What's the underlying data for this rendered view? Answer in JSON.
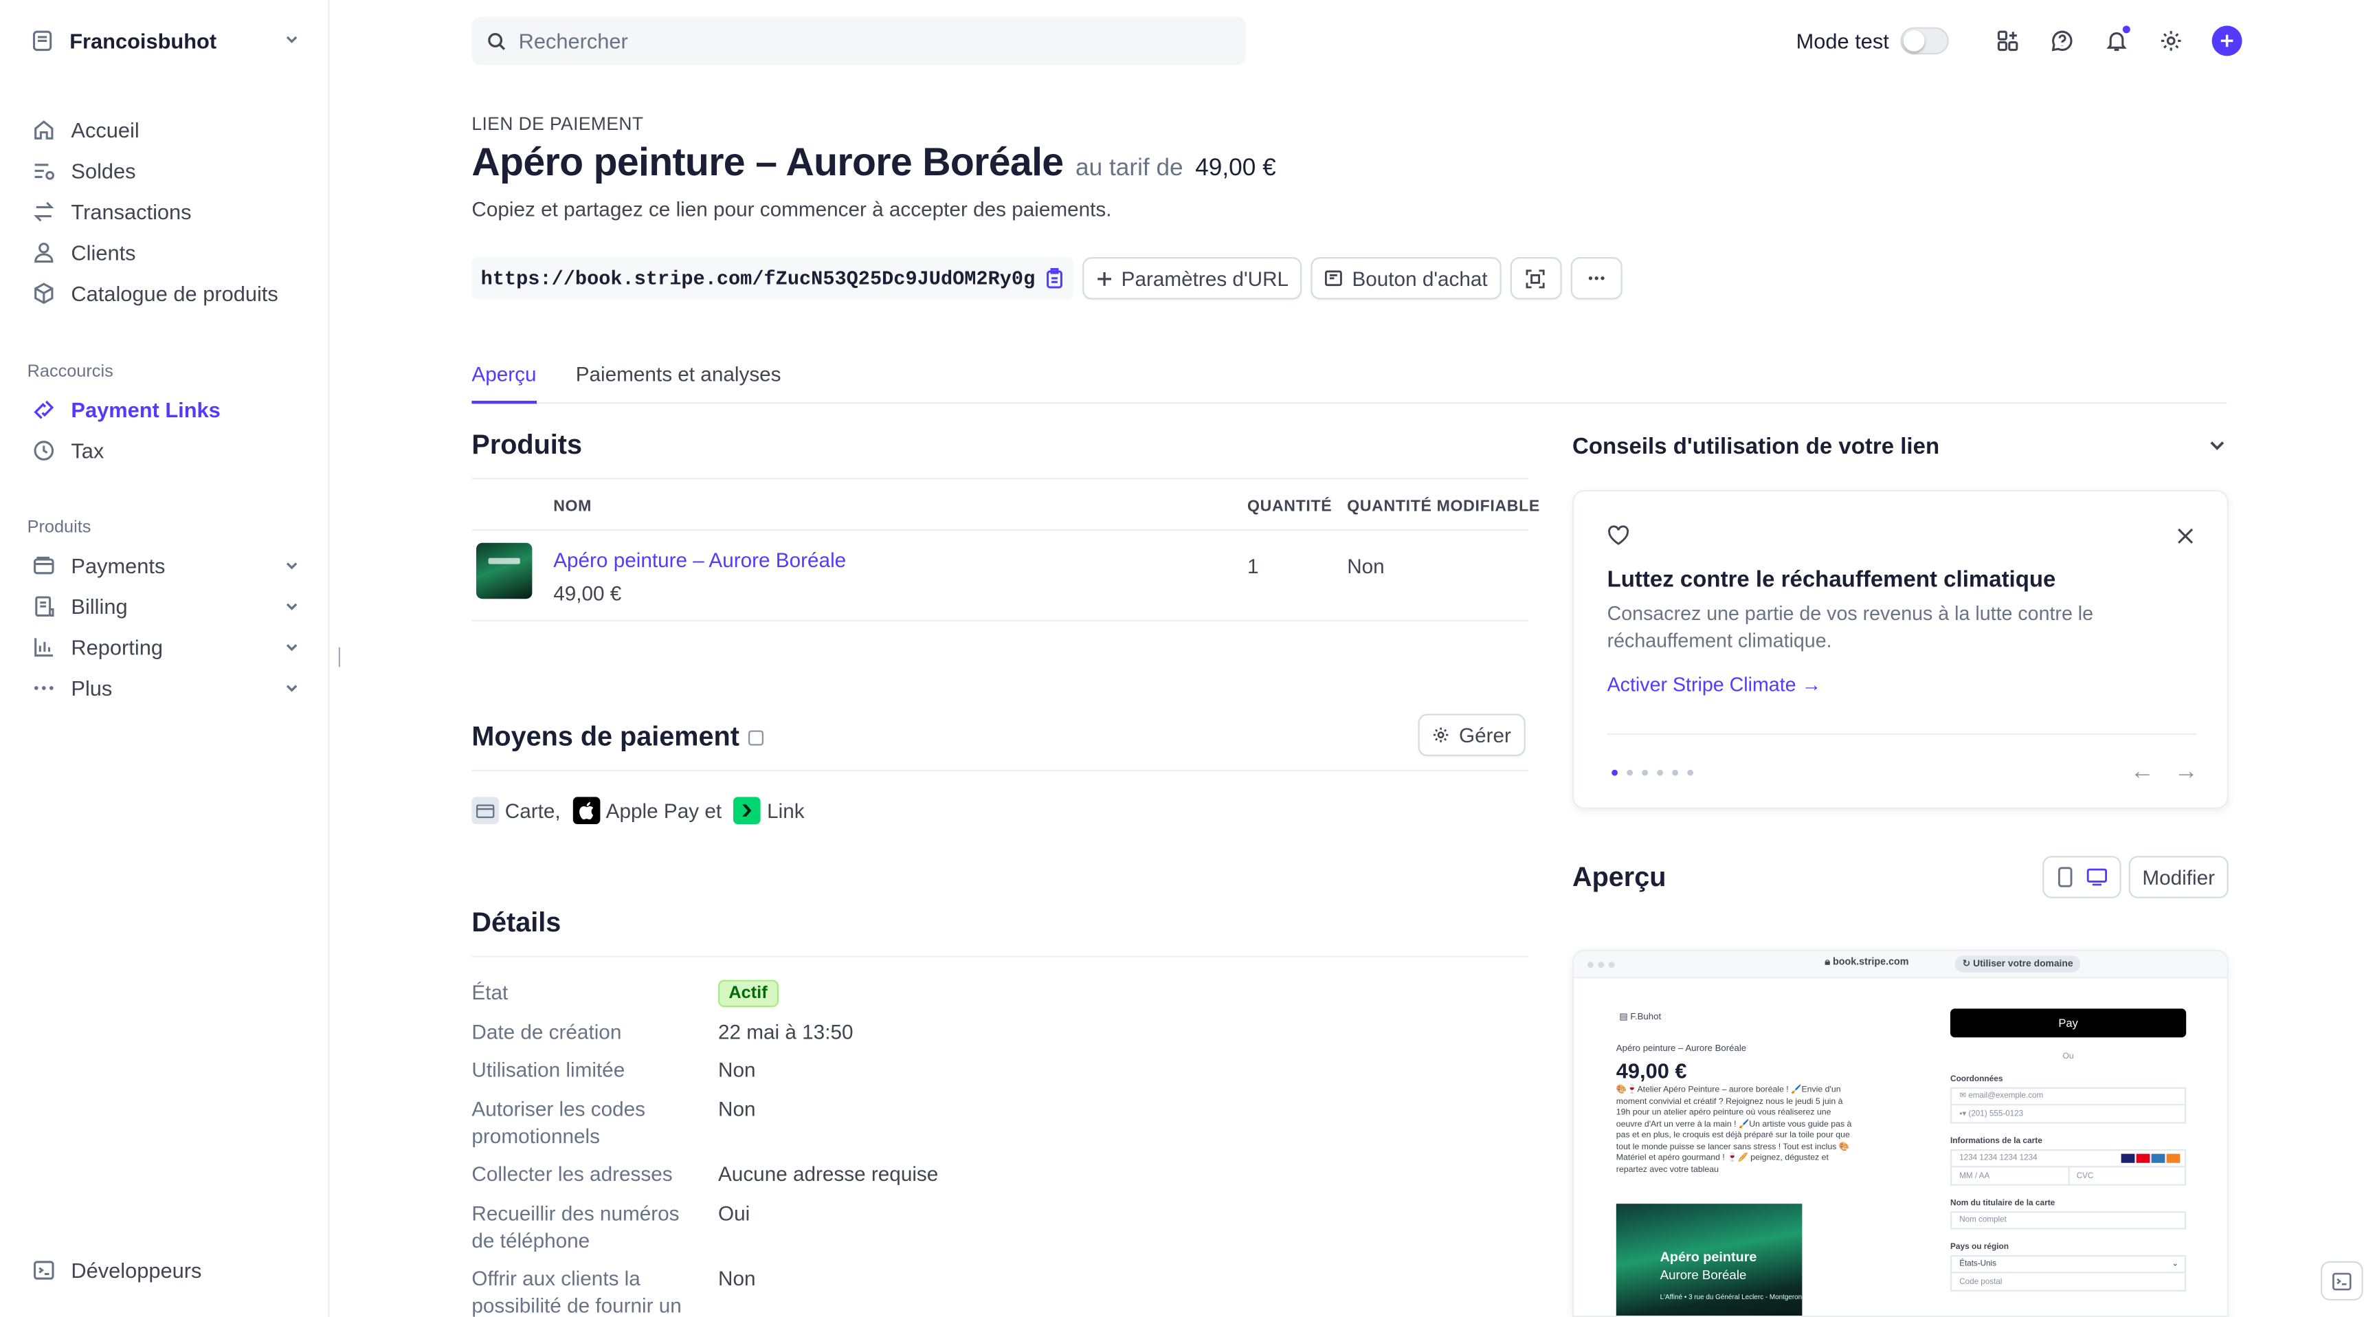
{
  "sidebar": {
    "account": "Francoisbuhot",
    "main_items": [
      {
        "label": "Accueil",
        "icon": "home-icon"
      },
      {
        "label": "Soldes",
        "icon": "balance-icon"
      },
      {
        "label": "Transactions",
        "icon": "arrows-icon"
      },
      {
        "label": "Clients",
        "icon": "person-icon"
      },
      {
        "label": "Catalogue de produits",
        "icon": "box-icon"
      }
    ],
    "shortcuts_title": "Raccourcis",
    "shortcuts": [
      {
        "label": "Payment Links",
        "icon": "link-icon"
      },
      {
        "label": "Tax",
        "icon": "clock-icon"
      }
    ],
    "products_title": "Produits",
    "products": [
      {
        "label": "Payments",
        "icon": "wallet-icon"
      },
      {
        "label": "Billing",
        "icon": "billing-icon"
      },
      {
        "label": "Reporting",
        "icon": "bar-chart-icon"
      },
      {
        "label": "Plus",
        "icon": "more-icon"
      }
    ],
    "developers": "Développeurs"
  },
  "topbar": {
    "search_placeholder": "Rechercher",
    "mode_label": "Mode test",
    "mode_on": false
  },
  "header": {
    "eyebrow": "LIEN DE PAIEMENT",
    "title": "Apéro peinture – Aurore Boréale",
    "at": "au tarif de",
    "price": "49,00 €",
    "subtitle": "Copiez et partagez ce lien pour commencer à accepter des paiements.",
    "url": "https://book.stripe.com/fZucN53Q25Dc9JUdOM2Ry0g",
    "url_params": "Paramètres d'URL",
    "buy_button": "Bouton d'achat"
  },
  "tabs": [
    "Aperçu",
    "Paiements et analyses"
  ],
  "products": {
    "title": "Produits",
    "col_name": "NOM",
    "col_qty": "QUANTITÉ",
    "col_qty_mod": "QUANTITÉ MODIFIABLE",
    "rows": [
      {
        "name": "Apéro peinture – Aurore Boréale",
        "price": "49,00 €",
        "qty": "1",
        "qty_mod": "Non"
      }
    ]
  },
  "payment_methods": {
    "title": "Moyens de paiement",
    "manage": "Gérer",
    "card": "Carte,",
    "apple": "Apple Pay et",
    "link": "Link"
  },
  "details": {
    "title": "Détails",
    "status_label": "État",
    "status_value": "Actif",
    "rows": [
      {
        "label": "Date de création",
        "value": "22 mai à 13:50"
      },
      {
        "label": "Utilisation limitée",
        "value": "Non"
      },
      {
        "label": "Autoriser les codes promotionnels",
        "value": "Non"
      },
      {
        "label": "Collecter les adresses",
        "value": "Aucune adresse requise"
      },
      {
        "label": "Recueillir des numéros de téléphone",
        "value": "Oui"
      },
      {
        "label": "Offrir aux clients la possibilité de fournir un",
        "value": "Non"
      }
    ]
  },
  "tips": {
    "title": "Conseils d'utilisation de votre lien",
    "card_title": "Luttez contre le réchauffement climatique",
    "card_desc": "Consacrez une partie de vos revenus à la lutte contre le réchauffement climatique.",
    "card_link": "Activer Stripe Climate",
    "pages": 6,
    "current_page": 1
  },
  "preview": {
    "title": "Aperçu",
    "edit": "Modifier",
    "domain": "book.stripe.com",
    "use_domain": "Utiliser votre domaine",
    "merchant": "F.Buhot",
    "product": "Apéro peinture – Aurore Boréale",
    "price": "49,00 €",
    "description": "🎨🍷Atelier Apéro Peinture – aurore boréale ! 🖌️Envie d'un moment convivial et créatif ? Rejoignez nous le jeudi 5 juin à 19h pour un atelier apéro peinture où vous réaliserez une oeuvre d'Art un verre à la main ! 🖌️Un artiste vous guide pas à pas et en plus, le croquis est déjà préparé sur la toile pour que tout le monde puisse se lancer sans stress ! Tout est inclus 🎨Matériel et apéro gourmand ! 🍷🥖 peignez, dégustez et repartez avec votre tableau",
    "img_title1": "Apéro peinture",
    "img_title2": "Aurore Boréale",
    "img_sub": "L'Affiné • 3 rue du Général Leclerc - Montgeron",
    "apple_pay": " Pay",
    "or": "Ou",
    "contact_label": "Coordonnées",
    "email_placeholder": "email@exemple.com",
    "phone_placeholder": "(201) 555-0123",
    "card_label": "Informations de la carte",
    "card_placeholder": "1234 1234 1234 1234",
    "exp_placeholder": "MM / AA",
    "cvc_placeholder": "CVC",
    "holder_label": "Nom du titulaire de la carte",
    "holder_placeholder": "Nom complet",
    "country_label": "Pays ou région",
    "country_value": "États-Unis",
    "postal_placeholder": "Code postal"
  }
}
